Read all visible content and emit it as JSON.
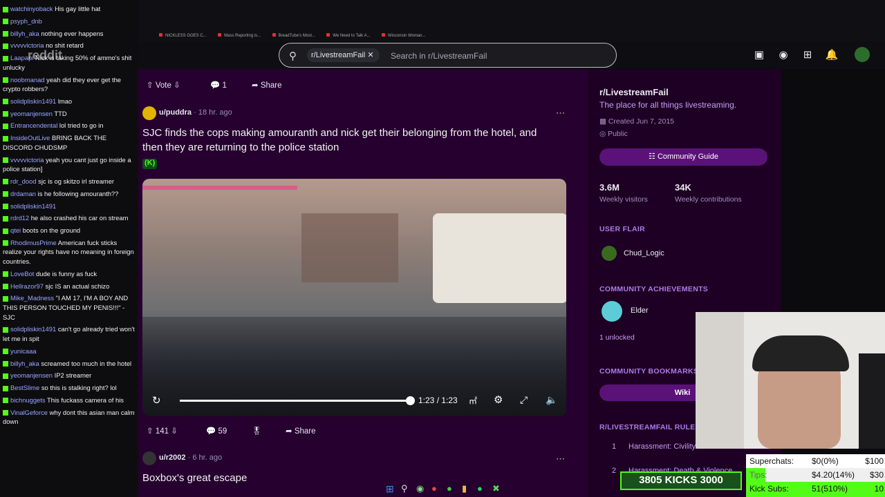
{
  "chat": [
    {
      "user": "watchinyoback",
      "text": "His gay little hat"
    },
    {
      "user": "psyph_dnb",
      "text": ""
    },
    {
      "user": "billyh_aka",
      "text": "nothing ever happens"
    },
    {
      "user": "vvvvvictoria",
      "text": "no shit retard"
    },
    {
      "user": "Laapapi",
      "text": "Nick is taking 50% of ammo's shit unlucky"
    },
    {
      "user": "noobmanad",
      "text": "yeah did they ever get the crypto robbers?"
    },
    {
      "user": "solidpliskin1491",
      "text": "lmao"
    },
    {
      "user": "yeomanjensen",
      "text": "TTD"
    },
    {
      "user": "Entrancendental",
      "text": "lol tried to go in"
    },
    {
      "user": "InsideOutLive",
      "text": "BRING BACK THE DISCORD CHUDSMP"
    },
    {
      "user": "vvvvvictoria",
      "text": "yeah you cant just go inside a police station]"
    },
    {
      "user": "rdr_dood",
      "text": "sjc is og skitzo irl streamer"
    },
    {
      "user": "drdaman",
      "text": "is he following amouranth??"
    },
    {
      "user": "solidpliskin1491",
      "text": ""
    },
    {
      "user": "rdrd12",
      "text": "he also crashed his car on stream"
    },
    {
      "user": "qtei",
      "text": "boots on the ground"
    },
    {
      "user": "RhodimusPrime",
      "text": "American fuck sticks realize your rights have no meaning in foreign countries."
    },
    {
      "user": "LoveBot",
      "text": "dude is funny as fuck"
    },
    {
      "user": "Hellrazor97",
      "text": "sjc IS an actual schizo"
    },
    {
      "user": "Mike_Madness",
      "text": "\"I AM 17, I'M A BOY AND THIS PERSON TOUCHED MY PENIS!!!\" - SJC"
    },
    {
      "user": "solidpliskin1491",
      "text": "can't go already tried won't let me in spit"
    },
    {
      "user": "yunicaaa",
      "text": ""
    },
    {
      "user": "billyh_aka",
      "text": "screamed too much in the hotel"
    },
    {
      "user": "yeomanjensen",
      "text": "IP2 streamer"
    },
    {
      "user": "BestSlime",
      "text": "so this is stalking right? lol"
    },
    {
      "user": "bichnuggets",
      "text": "This fuckass camera of his"
    },
    {
      "user": "VinalGeforce",
      "text": "why dont this asian man calm down"
    }
  ],
  "browser": {
    "tabs": [
      "NICKLESS GOES C...",
      "Mass Reporting is...",
      "BreadTube's Most...",
      "We Need to Talk A...",
      "Wisconsin Woman..."
    ],
    "brand": "reddit"
  },
  "search": {
    "chip": "r/LivestreamFail",
    "placeholder": "Search in r/LivestreamFail"
  },
  "post0": {
    "vote": "Vote",
    "comments": "1",
    "share": "Share"
  },
  "post1": {
    "author": "u/puddra",
    "time": "18 hr. ago",
    "title": "SJC finds the cops making amouranth and nick get their belonging from the hotel, and then they are returning to the police station",
    "flair": "(K)",
    "video_time": "1:23 / 1:23",
    "video_progress": 1.0,
    "votes": "141",
    "comments": "59",
    "share": "Share"
  },
  "post2": {
    "author": "u/r2002",
    "time": "6 hr. ago",
    "title": "Boxbox's great escape"
  },
  "sidebar": {
    "name": "r/LivestreamFail",
    "desc": "The place for all things livestreaming.",
    "created": "Created Jun 7, 2015",
    "visibility": "Public",
    "guide": "Community Guide",
    "visitors": "3.6M",
    "visitors_label": "Weekly visitors",
    "contrib": "34K",
    "contrib_label": "Weekly contributions",
    "user_flair_head": "USER FLAIR",
    "user_flair": "Chud_Logic",
    "ach_head": "COMMUNITY ACHIEVEMENTS",
    "ach": "Elder",
    "ach_unlocked": "1 unlocked",
    "bookmarks_head": "COMMUNITY BOOKMARKS",
    "bookmark": "Wiki",
    "rules_head": "R/LIVESTREAMFAIL RULES",
    "rule1_num": "1",
    "rule1": "Harassment: Civility",
    "rule2_num": "2",
    "rule2": "Harassment: Death & Violence"
  },
  "overlay": {
    "kicks": "3805  KICKS  3000",
    "superchats_label": "Superchats:",
    "superchats_val": "$0(0%)",
    "superchats_goal": "$100",
    "tips_label": "Tips:",
    "tips_val": "$4.20(14%)",
    "tips_goal": "$30",
    "subs_label": "Kick Subs:",
    "subs_val": "51(510%)",
    "subs_goal": "10",
    "tips_progress": 0.14,
    "subs_progress": 1.0
  },
  "colors": {
    "kick_green": "#53fc18",
    "reddit_purple": "#26002f",
    "accent": "#7c1fd6"
  }
}
